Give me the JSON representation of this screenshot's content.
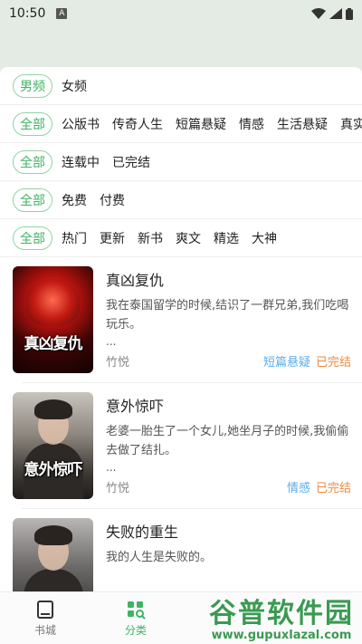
{
  "status_bar": {
    "time": "10:50",
    "notif_letter": "A"
  },
  "filters": [
    {
      "active": "男频",
      "options": [
        "女频"
      ]
    },
    {
      "active": "全部",
      "options": [
        "公版书",
        "传奇人生",
        "短篇悬疑",
        "情感",
        "生活悬疑",
        "真实"
      ]
    },
    {
      "active": "全部",
      "options": [
        "连载中",
        "已完结"
      ]
    },
    {
      "active": "全部",
      "options": [
        "免费",
        "付费"
      ]
    },
    {
      "active": "全部",
      "options": [
        "热门",
        "更新",
        "新书",
        "爽文",
        "精选",
        "大神"
      ]
    }
  ],
  "books": [
    {
      "title": "真凶复仇",
      "cover_text": "真凶复仇",
      "desc": "我在泰国留学的时候,结识了一群兄弟,我们吃喝玩乐。",
      "ellipsis": "...",
      "author": "竹悦",
      "category": "短篇悬疑",
      "status": "已完结"
    },
    {
      "title": "意外惊吓",
      "cover_text": "意外惊吓",
      "desc": "老婆一胎生了一个女儿,她坐月子的时候,我偷偷去做了结扎。",
      "ellipsis": "...",
      "author": "竹悦",
      "category": "情感",
      "status": "已完结"
    },
    {
      "title": "失败的重生",
      "cover_text": "",
      "desc": "我的人生是失败的。",
      "ellipsis": "",
      "author": "",
      "category": "",
      "status": ""
    }
  ],
  "bottom_nav": [
    {
      "label": "书城",
      "icon": "book-icon",
      "active": false
    },
    {
      "label": "分类",
      "icon": "category-icon",
      "active": true
    }
  ],
  "watermark": {
    "main": "谷普软件园",
    "url": "www.gupuxlazal.com"
  },
  "colors": {
    "accent": "#3fb462",
    "category_tag": "#5aaee8",
    "status_tag": "#f08a3c",
    "header_bg": "#e4ebe4"
  }
}
